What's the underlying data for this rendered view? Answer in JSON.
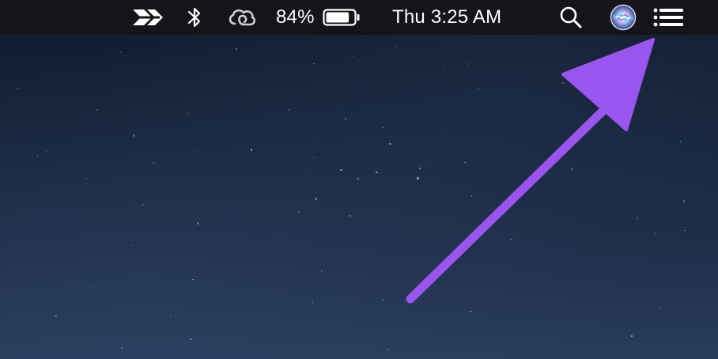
{
  "menubar": {
    "status_icons": [
      {
        "name": "kite-icon"
      },
      {
        "name": "bluetooth-icon"
      },
      {
        "name": "creative-cloud-icon"
      }
    ],
    "battery": {
      "percent_label": "84%",
      "level": 84
    },
    "clock": "Thu 3:25 AM",
    "right_icons": [
      {
        "name": "spotlight-search-icon"
      },
      {
        "name": "siri-icon"
      },
      {
        "name": "notification-center-icon"
      }
    ]
  },
  "annotation": {
    "arrow_color": "#9b55ef",
    "points_to": "notification-center-icon"
  },
  "colors": {
    "menubar": "#141418",
    "accent": "#9b55ef"
  }
}
